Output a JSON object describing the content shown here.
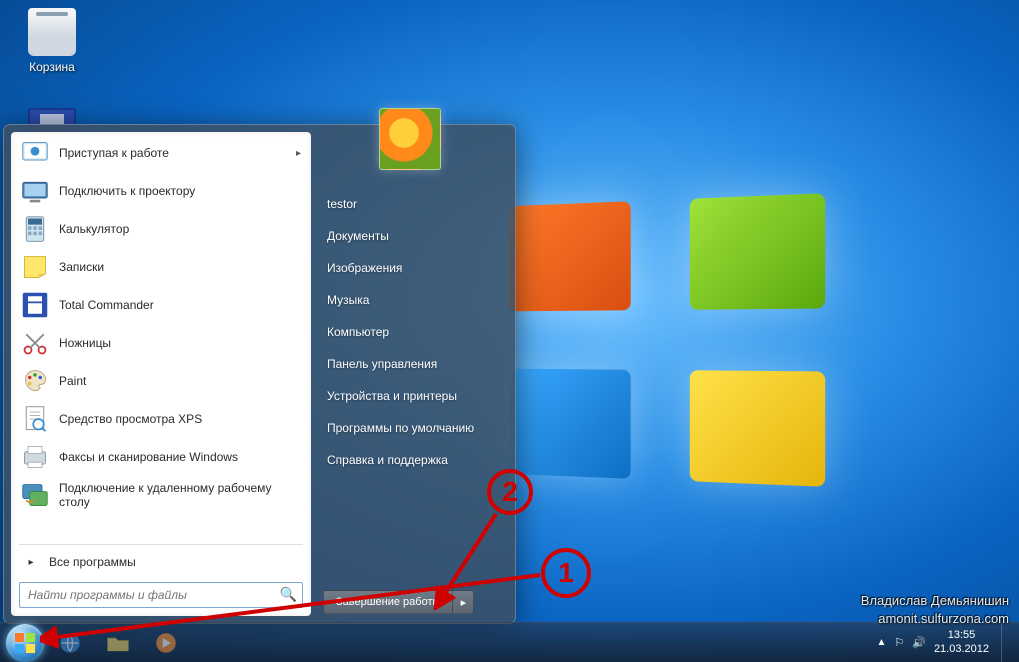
{
  "desktop": {
    "recycle_bin": "Корзина"
  },
  "start_menu": {
    "programs": [
      {
        "label": "Приступая к работе",
        "sub": true,
        "icon": "getting-started"
      },
      {
        "label": "Подключить к проектору",
        "icon": "projector"
      },
      {
        "label": "Калькулятор",
        "icon": "calculator"
      },
      {
        "label": "Записки",
        "icon": "sticky-notes"
      },
      {
        "label": "Total Commander",
        "icon": "total-commander"
      },
      {
        "label": "Ножницы",
        "icon": "snipping"
      },
      {
        "label": "Paint",
        "icon": "paint"
      },
      {
        "label": "Средство просмотра XPS",
        "icon": "xps-viewer"
      },
      {
        "label": "Факсы и сканирование Windows",
        "icon": "fax-scan"
      },
      {
        "label": "Подключение к удаленному рабочему столу",
        "icon": "remote-desktop"
      }
    ],
    "all_programs": "Все программы",
    "search_placeholder": "Найти программы и файлы",
    "user": "testor",
    "right_links": [
      "Документы",
      "Изображения",
      "Музыка",
      "Компьютер",
      "Панель управления",
      "Устройства и принтеры",
      "Программы по умолчанию",
      "Справка и поддержка"
    ],
    "shutdown": "Завершение работы"
  },
  "taskbar": {
    "time": "13:55",
    "date": "21.03.2012"
  },
  "annotations": {
    "marker1": "1",
    "marker2": "2"
  },
  "watermark": {
    "line1": "Владислав Демьянишин",
    "line2": "amonit.sulfurzona.com"
  }
}
